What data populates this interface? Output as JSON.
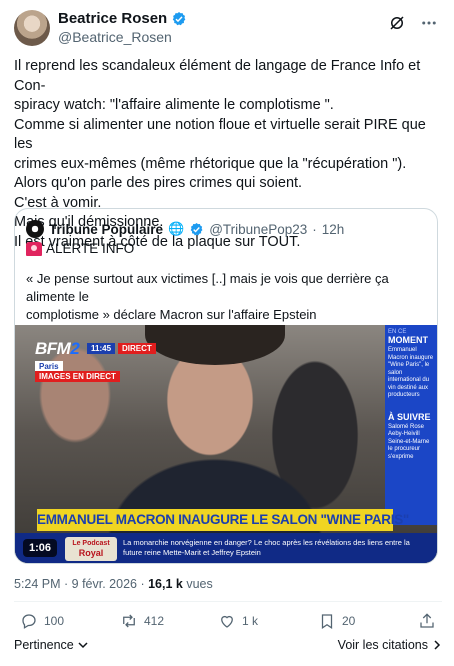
{
  "author": {
    "display_name": "Beatrice Rosen",
    "handle": "@Beatrice_Rosen"
  },
  "tweet": {
    "lines": [
      "Il reprend les scandaleux élément de langage de France Info et Con-",
      "spiracy watch: \"l'affaire alimente le complotisme \".",
      "Comme si alimenter une notion floue et virtuelle serait PIRE que les",
      "crimes eux-mêmes (même rhétorique que la \"récupération \").",
      "Alors qu'on parle des pires crimes qui soient.",
      "C'est à vomir.",
      "Mais qu'il démissionne.",
      "Il est vraiment à côté de la plaque sur TOUT."
    ]
  },
  "quote": {
    "display_name": "Tribune Populaire",
    "handle": "@TribunePop23",
    "time": "12h",
    "alert": "ALERTE INFO",
    "text_line1": "« Je pense surtout aux victimes [..] mais je vois que derrière ça alimente le",
    "text_line2": "complotisme » déclare Macron sur l'affaire Epstein",
    "ellipsis": "...",
    "video": {
      "channel": "BFM",
      "channel_suffix": "2",
      "clock": "11:45",
      "live_badge": "DIRECT",
      "location": "Paris",
      "images_badge": "IMAGES EN DIRECT",
      "side_label": "EN CE",
      "side_title": "MOMENT",
      "side_text": "Emmanuel Macron inaugure \"Wine Paris\", le salon international du vin destiné aux producteurs",
      "side_title2": "À SUIVRE",
      "side_text2": "Salomé Rose Aeby-Heivill Seine-et-Marne le procureur s'exprime",
      "headline": "EMMANUEL MACRON INAUGURE LE SALON \"WINE PARIS\"",
      "duration": "1:06",
      "podcast_line1": "Le Podcast",
      "podcast_line2": "Royal",
      "ticker_text": "La monarchie norvégienne en danger? Le choc après les révélations des liens entre la future reine Mette-Marit et Jeffrey Epstein"
    }
  },
  "meta": {
    "time_date": "5:24 PM · 9 févr. 2026 · ",
    "views_count": "16,1 k",
    "views_label": " vues"
  },
  "actions": {
    "replies": "100",
    "reposts": "412",
    "likes": "1 k",
    "bookmarks": "20"
  },
  "footer": {
    "relevance": "Pertinence",
    "quotes_link": "Voir les citations"
  },
  "colors": {
    "verified": "#1d9bf0",
    "muted": "#536471",
    "border": "#cfd9de",
    "bfm_blue": "#1b3fae",
    "headline_yellow": "#f0d522"
  }
}
